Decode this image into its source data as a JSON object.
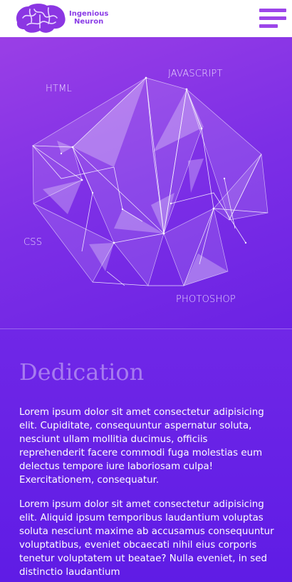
{
  "header": {
    "brand_line1": "Ingenious",
    "brand_line2": "Neuron",
    "logo_icon": "brain-icon",
    "menu_icon": "hamburger-menu-icon"
  },
  "hero": {
    "skills": {
      "html": "HTML",
      "javascript": "JAVASCRIPT",
      "css": "CSS",
      "photoshop": "PHOTOSHOP"
    }
  },
  "dedication": {
    "title": "Dedication",
    "paragraph1": "Lorem ipsum dolor sit amet consectetur adipisicing elit. Cupiditate, consequuntur aspernatur soluta, nesciunt ullam mollitia ducimus, officiis reprehenderit facere commodi fuga molestias eum delectus tempore iure laboriosam culpa! Exercitationem, consequatur.",
    "paragraph2": "Lorem ipsum dolor sit amet consectetur adipisicing elit. Aliquid ipsum temporibus laudantium voluptas soluta nesciunt maxime ab accusamus consequuntur voluptatibus, eveniet obcaecati nihil eius corporis tenetur voluptatem ut beatae? Nulla eveniet, in sed distinctio laudantium"
  },
  "colors": {
    "accent": "#9c45e9",
    "hero_top": "#9a3fe6",
    "content_bottom": "#5f1ce5",
    "title": "#a77cef"
  }
}
